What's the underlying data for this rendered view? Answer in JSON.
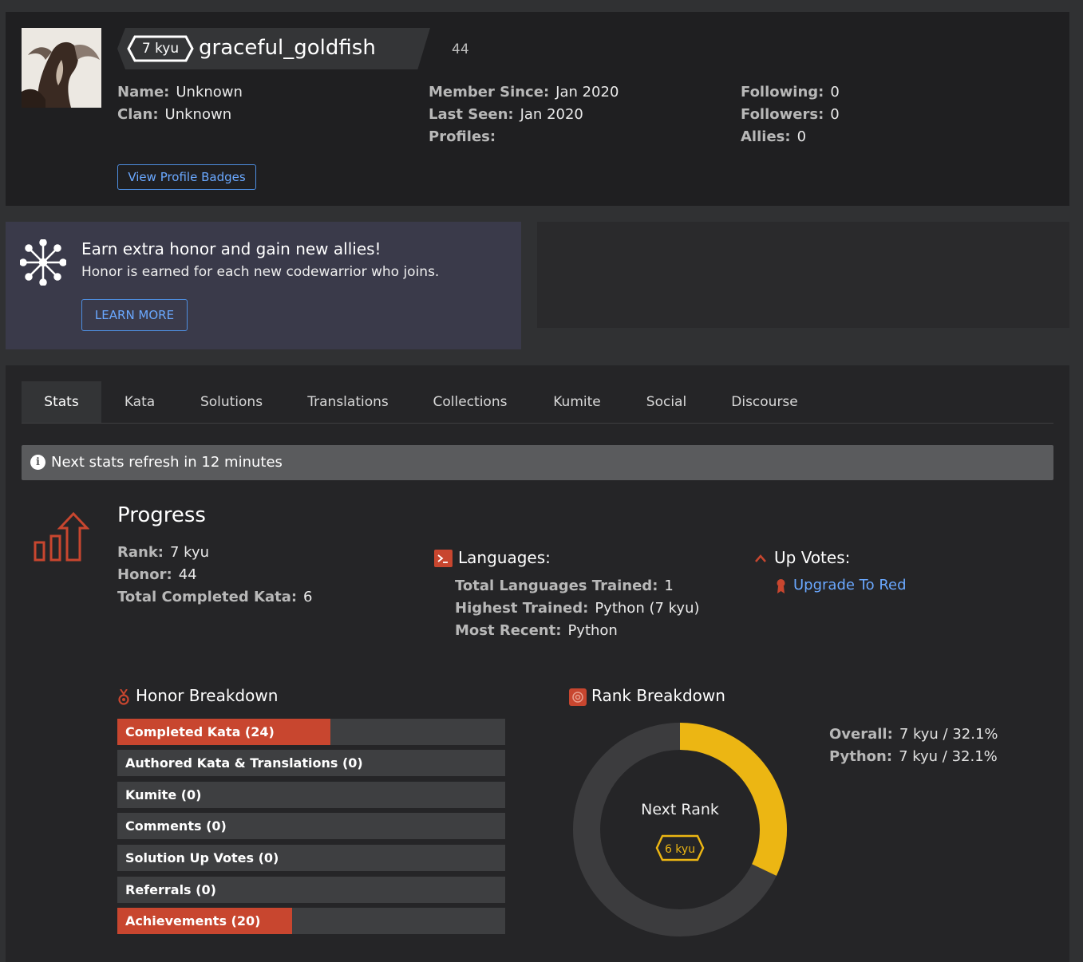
{
  "profile": {
    "rank": "7 kyu",
    "username": "graceful_goldfish",
    "honor": "44",
    "col1": [
      {
        "label": "Name:",
        "value": "Unknown"
      },
      {
        "label": "Clan:",
        "value": "Unknown"
      }
    ],
    "col2": [
      {
        "label": "Member Since:",
        "value": "Jan 2020"
      },
      {
        "label": "Last Seen:",
        "value": "Jan 2020"
      },
      {
        "label": "Profiles:",
        "value": ""
      }
    ],
    "col3": [
      {
        "label": "Following:",
        "value": "0"
      },
      {
        "label": "Followers:",
        "value": "0"
      },
      {
        "label": "Allies:",
        "value": "0"
      }
    ],
    "badges_button": "View Profile Badges"
  },
  "banner": {
    "title": "Earn extra honor and gain new allies!",
    "subtitle": "Honor is earned for each new codewarrior who joins.",
    "button": "LEARN MORE"
  },
  "tabs": [
    {
      "label": "Stats",
      "active": true
    },
    {
      "label": "Kata"
    },
    {
      "label": "Solutions"
    },
    {
      "label": "Translations"
    },
    {
      "label": "Collections"
    },
    {
      "label": "Kumite"
    },
    {
      "label": "Social"
    },
    {
      "label": "Discourse"
    }
  ],
  "notice": "Next stats refresh in 12 minutes",
  "progress": {
    "title": "Progress",
    "items": [
      {
        "label": "Rank:",
        "value": "7 kyu"
      },
      {
        "label": "Honor:",
        "value": "44"
      },
      {
        "label": "Total Completed Kata:",
        "value": "6"
      }
    ]
  },
  "languages": {
    "title": "Languages:",
    "items": [
      {
        "label": "Total Languages Trained:",
        "value": "1"
      },
      {
        "label": "Highest Trained:",
        "value": "Python (7 kyu)"
      },
      {
        "label": "Most Recent:",
        "value": "Python"
      }
    ]
  },
  "upvotes": {
    "title": "Up Votes:",
    "link": "Upgrade To Red"
  },
  "honor_breakdown": {
    "title": "Honor Breakdown",
    "bars": [
      {
        "label": "Completed Kata (24)",
        "fraction": 0.55
      },
      {
        "label": "Authored Kata & Translations (0)",
        "fraction": 0
      },
      {
        "label": "Kumite (0)",
        "fraction": 0
      },
      {
        "label": "Comments (0)",
        "fraction": 0
      },
      {
        "label": "Solution Up Votes (0)",
        "fraction": 0
      },
      {
        "label": "Referrals (0)",
        "fraction": 0
      },
      {
        "label": "Achievements (20)",
        "fraction": 0.45
      }
    ]
  },
  "rank_breakdown": {
    "title": "Rank Breakdown",
    "center_label": "Next Rank",
    "next_rank": "6 kyu",
    "progress_percent": 32.1,
    "lines": [
      {
        "label": "Overall:",
        "value": "7 kyu / 32.1%"
      },
      {
        "label": "Python:",
        "value": "7 kyu / 32.1%"
      }
    ]
  },
  "colors": {
    "accent_red": "#c8462f",
    "link_blue": "#6aa8ff",
    "donut_yellow": "#ecb613",
    "donut_track": "#3c3c3e"
  }
}
